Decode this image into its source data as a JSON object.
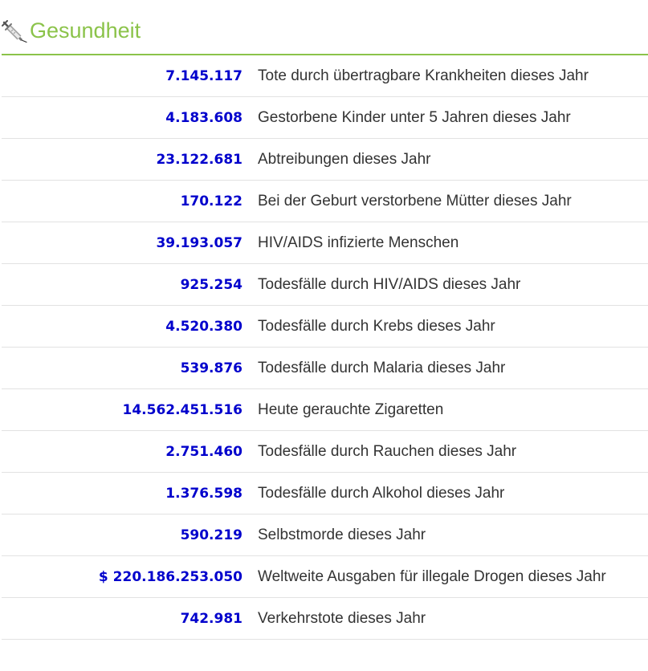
{
  "section": {
    "title": "Gesundheit",
    "icon": "syringe-icon",
    "accent_color": "#8bc34a",
    "value_color": "#0000cc"
  },
  "rows": [
    {
      "value": "7.145.117",
      "label": "Tote durch übertragbare Krankheiten dieses Jahr"
    },
    {
      "value": "4.183.608",
      "label": "Gestorbene Kinder unter 5 Jahren dieses Jahr"
    },
    {
      "value": "23.122.681",
      "label": "Abtreibungen dieses Jahr"
    },
    {
      "value": "170.122",
      "label": "Bei der Geburt verstorbene Mütter dieses Jahr"
    },
    {
      "value": "39.193.057",
      "label": "HIV/AIDS infizierte Menschen"
    },
    {
      "value": "925.254",
      "label": "Todesfälle durch HIV/AIDS dieses Jahr"
    },
    {
      "value": "4.520.380",
      "label": "Todesfälle durch Krebs dieses Jahr"
    },
    {
      "value": "539.876",
      "label": "Todesfälle durch Malaria dieses Jahr"
    },
    {
      "value": "14.562.451.516",
      "label": "Heute gerauchte Zigaretten"
    },
    {
      "value": "2.751.460",
      "label": "Todesfälle durch Rauchen dieses Jahr"
    },
    {
      "value": "1.376.598",
      "label": "Todesfälle durch Alkohol dieses Jahr"
    },
    {
      "value": "590.219",
      "label": "Selbstmorde dieses Jahr"
    },
    {
      "value": "$ 220.186.253.050",
      "label": "Weltweite Ausgaben für illegale Drogen dieses Jahr"
    },
    {
      "value": "742.981",
      "label": "Verkehrstote dieses Jahr"
    }
  ]
}
